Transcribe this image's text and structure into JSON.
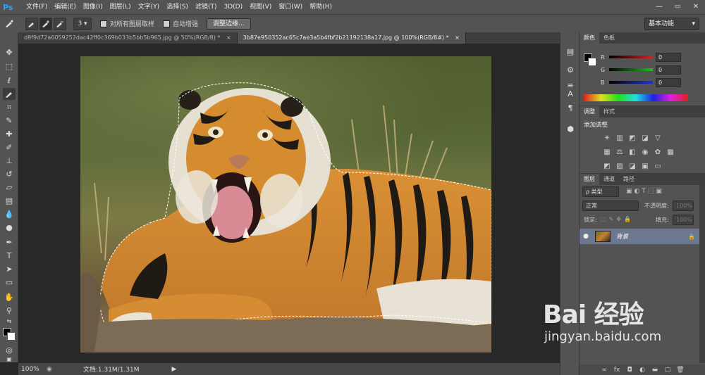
{
  "app": {
    "logo": "Ps"
  },
  "menu": [
    "文件(F)",
    "编辑(E)",
    "图像(I)",
    "图层(L)",
    "文字(Y)",
    "选择(S)",
    "滤镜(T)",
    "3D(D)",
    "视图(V)",
    "窗口(W)",
    "帮助(H)"
  ],
  "window_controls": {
    "minimize": "—",
    "restore": "▭",
    "close": "✕"
  },
  "options": {
    "brush_size": "3",
    "sample_all_layers": "对所有图层取样",
    "auto_enhance": "自动增强",
    "refine_edge": "调整边缘...",
    "workspace": "基本功能"
  },
  "tabs": [
    {
      "label": "d8f9d72a6059252dac42ff0c369b033b5bb5b965.jpg @ 50%(RGB/8) *",
      "close": "×"
    },
    {
      "label": "3b87e950352ac65c7ae3a5b4fbf2b21192138a17.jpg @ 100%(RGB/8#) *",
      "close": "×"
    }
  ],
  "status": {
    "zoom": "100%",
    "doc": "文档:1.31M/1.31M",
    "arrow": "▶"
  },
  "color_panel": {
    "tabs": [
      "颜色",
      "色板"
    ],
    "rows": [
      {
        "label": "R",
        "value": "0",
        "track": "linear-gradient(90deg,#000,#e02020)"
      },
      {
        "label": "G",
        "value": "0",
        "track": "linear-gradient(90deg,#000,#20c020)"
      },
      {
        "label": "B",
        "value": "0",
        "track": "linear-gradient(90deg,#000,#2030e0)"
      }
    ]
  },
  "adjust_panel": {
    "tabs": [
      "调整",
      "样式"
    ],
    "title": "添加调整"
  },
  "layers_panel": {
    "tabs": [
      "图层",
      "通道",
      "路径"
    ],
    "filter": "ρ 类型",
    "blend_mode": "正常",
    "opacity_label": "不透明度:",
    "opacity_value": "100%",
    "lock_label": "锁定:",
    "fill_label": "填充:",
    "fill_value": "100%",
    "layer": {
      "name": "背景",
      "eye": "●",
      "lock": "🔒"
    }
  },
  "watermark": {
    "logo": "Bai 经验",
    "url": "jingyan.baidu.com"
  }
}
